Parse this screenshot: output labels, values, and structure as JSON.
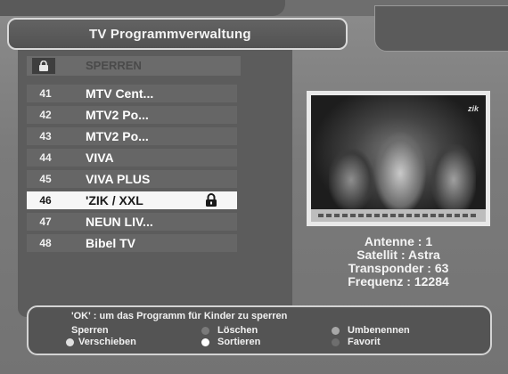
{
  "header": {
    "title": "TV Programmverwaltung"
  },
  "list": {
    "header_label": "SPERREN",
    "header_icon": "lock-icon",
    "rows": [
      {
        "num": "41",
        "name": "MTV Cent...",
        "locked": false,
        "selected": false
      },
      {
        "num": "42",
        "name": "MTV2 Po...",
        "locked": false,
        "selected": false
      },
      {
        "num": "43",
        "name": "MTV2 Po...",
        "locked": false,
        "selected": false
      },
      {
        "num": "44",
        "name": "VIVA",
        "locked": false,
        "selected": false
      },
      {
        "num": "45",
        "name": "VIVA PLUS",
        "locked": false,
        "selected": false
      },
      {
        "num": "46",
        "name": "'ZIK / XXL",
        "locked": true,
        "selected": true
      },
      {
        "num": "47",
        "name": "NEUN LIV...",
        "locked": false,
        "selected": false
      },
      {
        "num": "48",
        "name": "Bibel TV",
        "locked": false,
        "selected": false
      }
    ]
  },
  "info": {
    "antenne": "Antenne : 1",
    "satellit": "Satellit : Astra",
    "transponder": "Transponder : 63",
    "frequenz": "Frequenz : 12284"
  },
  "help": {
    "title": "'OK' : um das Programm für Kinder zu sperren",
    "sperren": "Sperren",
    "loeschen": "Löschen",
    "umbenennen": "Umbenennen",
    "verschieben": "Verschieben",
    "sortieren": "Sortieren",
    "favorit": "Favorit"
  },
  "colors": {
    "selected_row": "#f6f6f6",
    "dot_loeschen": "#7a7a7a",
    "dot_umbenennen": "#a8a8a8",
    "dot_verschieben": "#e0e0e0",
    "dot_sortieren": "#ffffff",
    "dot_favorit": "#6e6e6e"
  }
}
